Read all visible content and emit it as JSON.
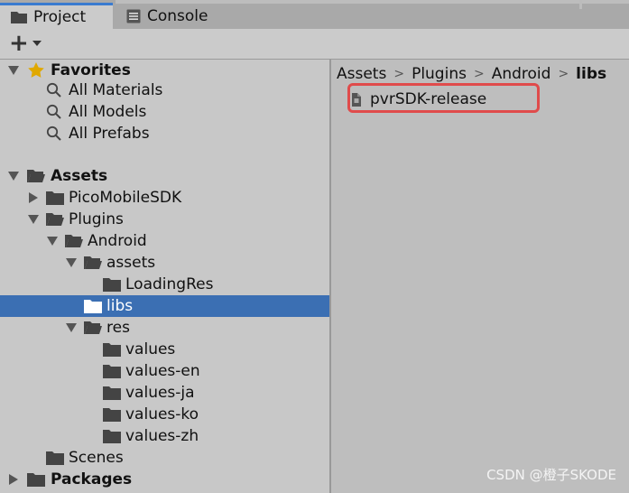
{
  "tabs": [
    {
      "label": "Project",
      "icon": "folder-icon",
      "active": true
    },
    {
      "label": "Console",
      "icon": "console-icon",
      "active": false
    }
  ],
  "toolbar": {
    "add_label": "+",
    "dropdown_icon": "chevron-down-icon"
  },
  "tree": {
    "favorites": {
      "label": "Favorites",
      "items": [
        "All Materials",
        "All Models",
        "All Prefabs"
      ]
    },
    "assets": {
      "label": "Assets",
      "pico": "PicoMobileSDK",
      "plugins": "Plugins",
      "android": "Android",
      "assets_folder": "assets",
      "loadingres": "LoadingRes",
      "libs": "libs",
      "res": "res",
      "values": [
        "values",
        "values-en",
        "values-ja",
        "values-ko",
        "values-zh"
      ],
      "scenes": "Scenes"
    },
    "packages": {
      "label": "Packages"
    },
    "selected": "libs"
  },
  "breadcrumb": [
    "Assets",
    "Plugins",
    "Android",
    "libs"
  ],
  "files": [
    {
      "name": "pvrSDK-release",
      "icon": "plugin-icon"
    }
  ],
  "colors": {
    "selection": "#3b6fb3",
    "highlight": "#e04b4b",
    "tab_accent": "#3a7bd0"
  },
  "watermark": "CSDN @橙子SKODE"
}
